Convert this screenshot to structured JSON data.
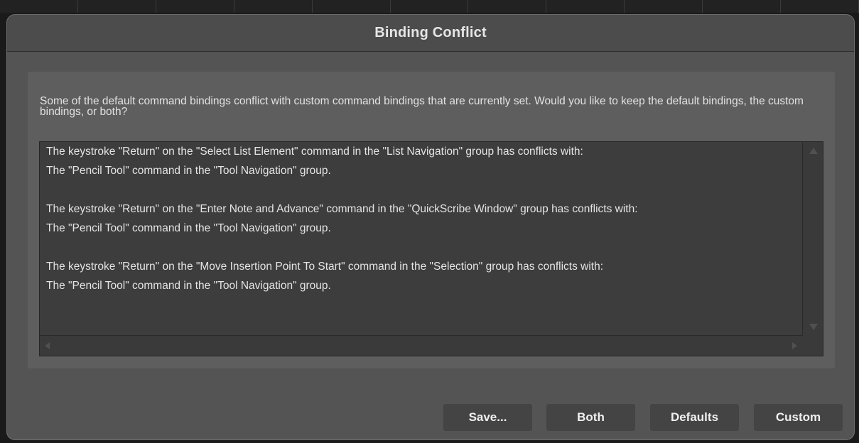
{
  "dialog": {
    "title": "Binding Conflict",
    "message": "Some of the default command bindings conflict with custom command bindings that are currently set.  Would you like to keep the default bindings, the custom bindings, or both?",
    "conflict_lines": [
      "The keystroke \"Return\" on the \"Select List Element\" command in the \"List Navigation\" group has conflicts with:",
      "The \"Pencil Tool\" command in the \"Tool Navigation\" group.",
      "",
      "The keystroke \"Return\" on the \"Enter Note and Advance\" command in the \"QuickScribe Window\" group has conflicts with:",
      "The \"Pencil Tool\" command in the \"Tool Navigation\" group.",
      "",
      "The keystroke \"Return\" on the \"Move Insertion Point To Start\" command in the \"Selection\" group has conflicts with:",
      "The \"Pencil Tool\" command in the \"Tool Navigation\" group."
    ],
    "buttons": {
      "save": "Save...",
      "both": "Both",
      "defaults": "Defaults",
      "custom": "Custom"
    }
  },
  "colors": {
    "dialog_bg": "#545454",
    "panel_bg": "#5e5e5e",
    "textbox_bg": "#3d3d3d",
    "button_bg": "#444444",
    "text": "#e4e4e4"
  }
}
